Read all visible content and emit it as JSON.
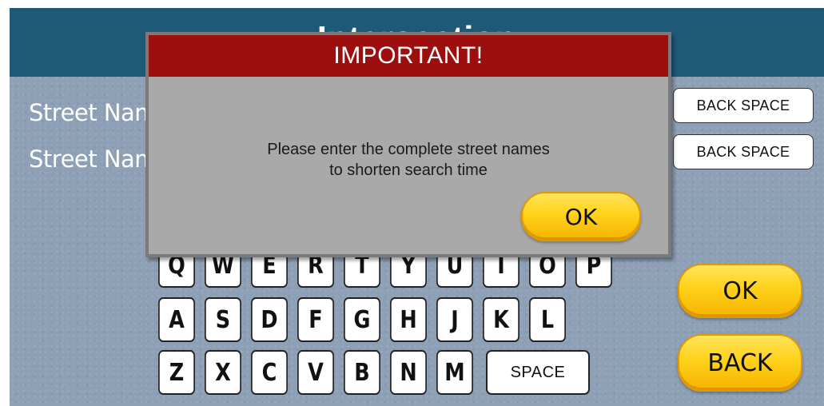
{
  "screen": {
    "title": "Intersection"
  },
  "form": {
    "street1_label": "Street Nam",
    "street2_label": "Street Nam",
    "street1_value": "",
    "street2_value": "",
    "backspace_label": "BACK SPACE"
  },
  "keyboard": {
    "row1": [
      "Q",
      "W",
      "E",
      "R",
      "T",
      "Y",
      "U",
      "I",
      "O",
      "P"
    ],
    "row2": [
      "A",
      "S",
      "D",
      "F",
      "G",
      "H",
      "J",
      "K",
      "L"
    ],
    "row3": [
      "Z",
      "X",
      "C",
      "V",
      "B",
      "N",
      "M"
    ],
    "space_label": "SPACE"
  },
  "actions": {
    "ok_label": "OK",
    "back_label": "BACK"
  },
  "dialog": {
    "title": "IMPORTANT!",
    "message_line1": "Please enter the complete street names",
    "message_line2": "to shorten search time",
    "ok_label": "OK"
  },
  "colors": {
    "title_bar": "#1e5a78",
    "dialog_header": "#9d0f0f",
    "dialog_body": "#a9a9a9",
    "button_gold": "#ffd21a"
  }
}
